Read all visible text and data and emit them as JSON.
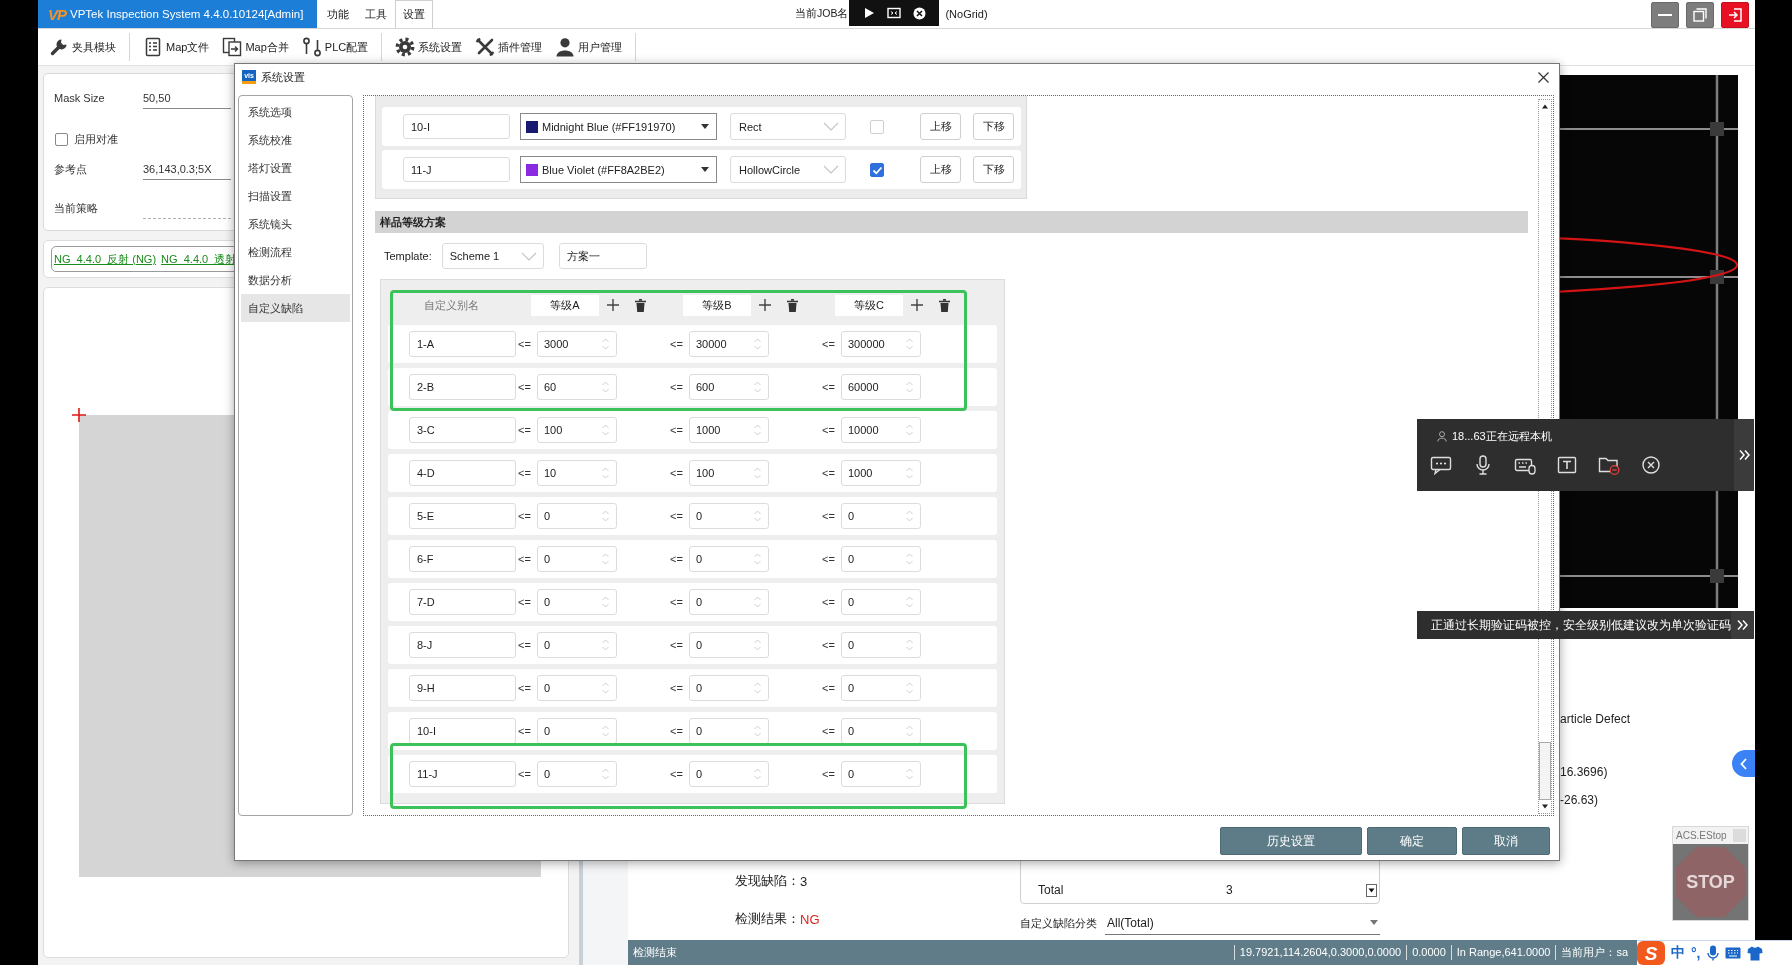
{
  "title_bar": {
    "logo": "VP",
    "title": "VPTek Inspection System 4.4.0.10124[Admin]",
    "menus": [
      {
        "label": "功能",
        "selected": false
      },
      {
        "label": "工具",
        "selected": false
      },
      {
        "label": "设置",
        "selected": true
      }
    ],
    "job_label": "当前JOB名",
    "grid_mode": "(NoGrid)"
  },
  "toolbar": {
    "groups": [
      {
        "items": [
          {
            "kind": "fixture",
            "label": "夹具模块"
          }
        ]
      },
      {
        "items": [
          {
            "kind": "document",
            "label": "Map文件"
          },
          {
            "kind": "merge",
            "label": "Map合并"
          },
          {
            "kind": "plc",
            "label": "PLC配置"
          }
        ]
      },
      {
        "items": [
          {
            "kind": "gear",
            "label": "系统设置"
          },
          {
            "kind": "tools",
            "label": "插件管理"
          },
          {
            "kind": "user",
            "label": "用户管理"
          }
        ]
      }
    ]
  },
  "left_panel": {
    "fields": [
      {
        "kind": "text",
        "label": "Mask Size",
        "value": "50,50"
      },
      {
        "kind": "checkbox",
        "label": "启用对准",
        "checked": false
      },
      {
        "kind": "text",
        "label": "参考点",
        "value": "36,143,0.3;5X"
      },
      {
        "kind": "blank",
        "label": "当前策略"
      }
    ],
    "links": [
      "NG_4.4.0_反射 (NG)",
      "NG_4.4.0_透射"
    ]
  },
  "results": {
    "defects_found": {
      "label": "发现缺陷：",
      "value": "3"
    },
    "result": {
      "label": "检测结果：",
      "value": "NG",
      "failed": true
    },
    "summary_rows": [
      {
        "label": "Total",
        "value": "3"
      }
    ],
    "category_filter": {
      "label": "自定义缺陷分类",
      "value": "All(Total)"
    }
  },
  "side_info": [
    "article Defect",
    "16.3696)",
    "-26.63)"
  ],
  "status_bar": {
    "message": "检测结束",
    "fields": [
      "19.7921,114.2604,0.3000,0.0000",
      "0.0000",
      "In Range,641.0000",
      "当前用户：sa"
    ]
  },
  "dialog": {
    "icon_label": "vis",
    "title": "系统设置",
    "nav": [
      {
        "label": "系统选项",
        "selected": false
      },
      {
        "label": "系统校准",
        "selected": false
      },
      {
        "label": "塔灯设置",
        "selected": false
      },
      {
        "label": "扫描设置",
        "selected": false
      },
      {
        "label": "系统镜头",
        "selected": false
      },
      {
        "label": "检测流程",
        "selected": false
      },
      {
        "label": "数据分析",
        "selected": false
      },
      {
        "label": "自定义缺陷",
        "selected": true
      }
    ],
    "defect_styles": [
      {
        "name": "10-I",
        "color_name": "Midnight Blue (#FF191970)",
        "color": "#191970",
        "shape": "Rect",
        "checked": false,
        "move_up": "上移",
        "move_down": "下移"
      },
      {
        "name": "11-J",
        "color_name": "Blue Violet (#FF8A2BE2)",
        "color": "#8a2be2",
        "shape": "HollowCircle",
        "checked": true,
        "move_up": "上移",
        "move_down": "下移"
      }
    ],
    "grade_section": {
      "title": "样品等级方案",
      "template_label": "Template:",
      "template": "Scheme 1",
      "scheme_name": "方案一",
      "alias_header": "自定义别名",
      "grades": [
        "等级A",
        "等级B",
        "等级C"
      ],
      "header_highlighted": true,
      "rows": [
        {
          "name": "1-A",
          "highlighted": true,
          "limits": [
            {
              "op": "<=",
              "value": "3000"
            },
            {
              "op": "<=",
              "value": "30000"
            },
            {
              "op": "<=",
              "value": "300000"
            }
          ]
        },
        {
          "name": "2-B",
          "highlighted": true,
          "limits": [
            {
              "op": "<=",
              "value": "60"
            },
            {
              "op": "<=",
              "value": "600"
            },
            {
              "op": "<=",
              "value": "60000"
            }
          ]
        },
        {
          "name": "3-C",
          "highlighted": false,
          "limits": [
            {
              "op": "<=",
              "value": "100"
            },
            {
              "op": "<=",
              "value": "1000"
            },
            {
              "op": "<=",
              "value": "10000"
            }
          ]
        },
        {
          "name": "4-D",
          "highlighted": false,
          "limits": [
            {
              "op": "<=",
              "value": "10"
            },
            {
              "op": "<=",
              "value": "100"
            },
            {
              "op": "<=",
              "value": "1000"
            }
          ]
        },
        {
          "name": "5-E",
          "highlighted": false,
          "limits": [
            {
              "op": "<=",
              "value": "0"
            },
            {
              "op": "<=",
              "value": "0"
            },
            {
              "op": "<=",
              "value": "0"
            }
          ]
        },
        {
          "name": "6-F",
          "highlighted": false,
          "limits": [
            {
              "op": "<=",
              "value": "0"
            },
            {
              "op": "<=",
              "value": "0"
            },
            {
              "op": "<=",
              "value": "0"
            }
          ]
        },
        {
          "name": "7-D",
          "highlighted": false,
          "limits": [
            {
              "op": "<=",
              "value": "0"
            },
            {
              "op": "<=",
              "value": "0"
            },
            {
              "op": "<=",
              "value": "0"
            }
          ]
        },
        {
          "name": "8-J",
          "highlighted": false,
          "limits": [
            {
              "op": "<=",
              "value": "0"
            },
            {
              "op": "<=",
              "value": "0"
            },
            {
              "op": "<=",
              "value": "0"
            }
          ]
        },
        {
          "name": "9-H",
          "highlighted": false,
          "limits": [
            {
              "op": "<=",
              "value": "0"
            },
            {
              "op": "<=",
              "value": "0"
            },
            {
              "op": "<=",
              "value": "0"
            }
          ]
        },
        {
          "name": "10-I",
          "highlighted": false,
          "limits": [
            {
              "op": "<=",
              "value": "0"
            },
            {
              "op": "<=",
              "value": "0"
            },
            {
              "op": "<=",
              "value": "0"
            }
          ]
        },
        {
          "name": "11-J",
          "highlighted": true,
          "limits": [
            {
              "op": "<=",
              "value": "0"
            },
            {
              "op": "<=",
              "value": "0"
            },
            {
              "op": "<=",
              "value": "0"
            }
          ]
        }
      ]
    },
    "buttons": [
      "历史设置",
      "确定",
      "取消"
    ]
  },
  "remote_panel": {
    "status": "18...63正在远程本机",
    "notice": "正通过长期验证码被控，安全级别低建议改为单次验证码"
  },
  "estop": {
    "title": "ACS.EStop",
    "sign": "STOP"
  },
  "ime_tray": {
    "logo": "S",
    "items": [
      "中",
      "°,"
    ]
  }
}
